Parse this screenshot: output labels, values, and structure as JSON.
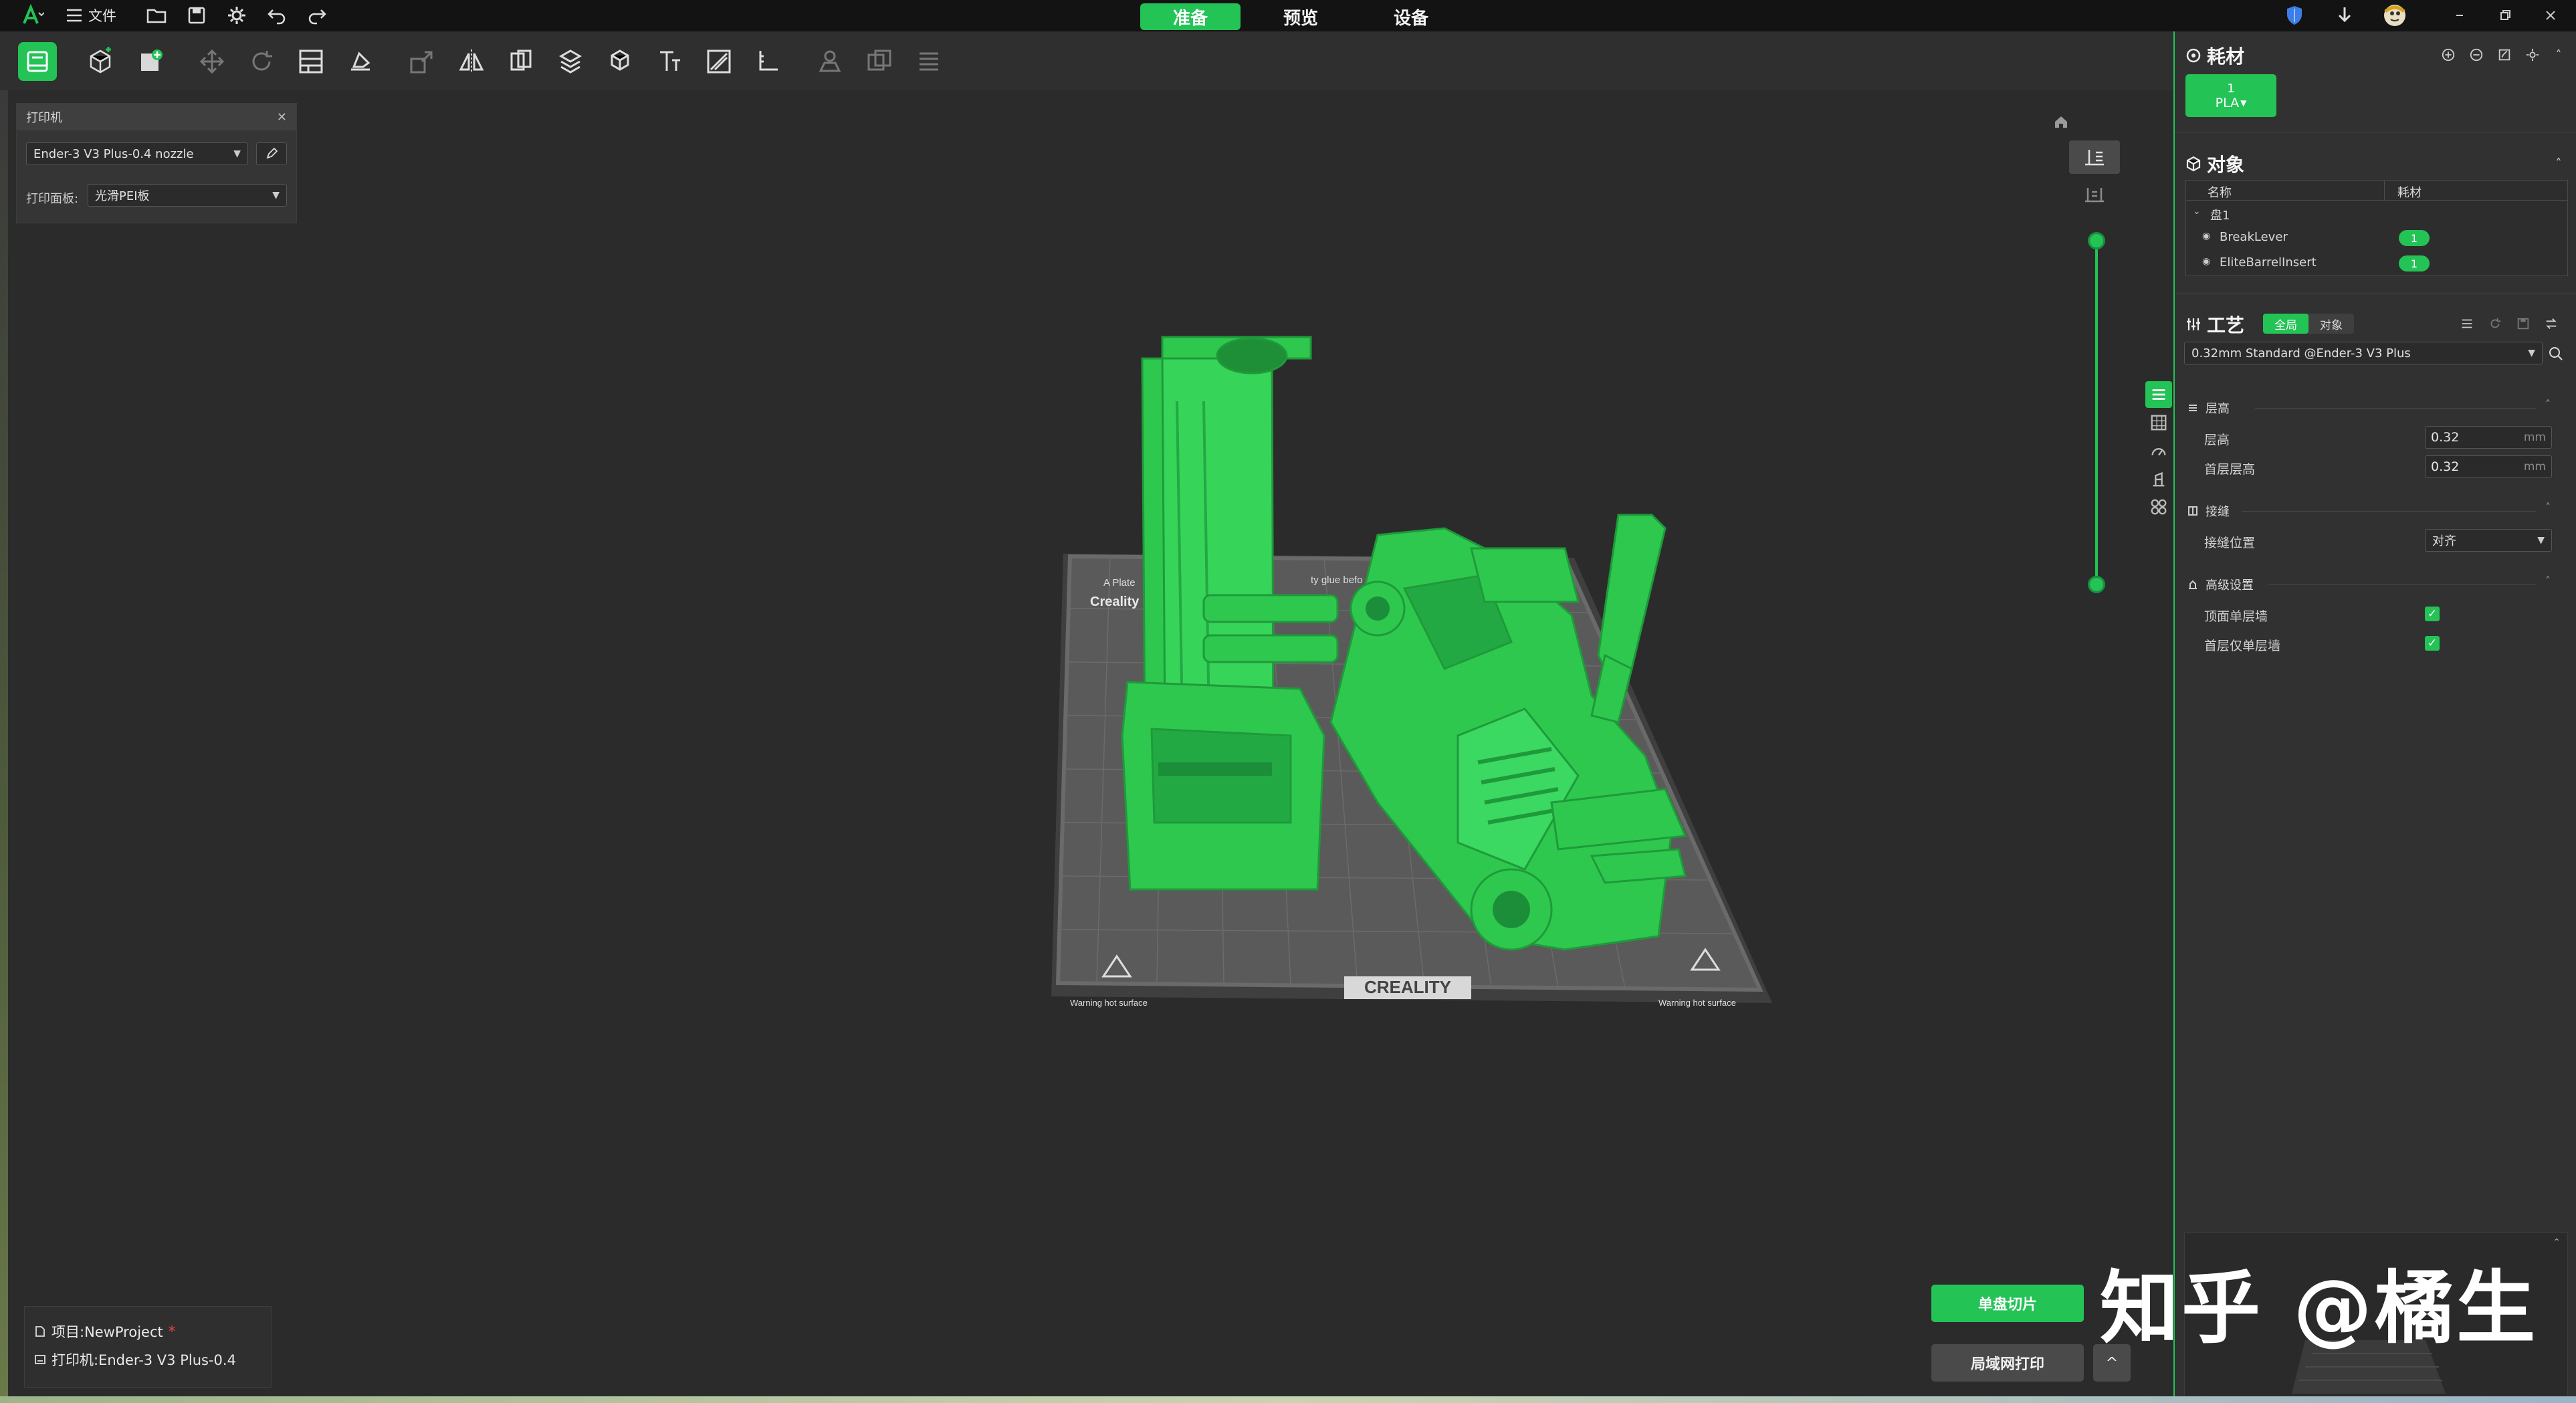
{
  "titlebar": {
    "file_menu": "文件",
    "tabs": {
      "prepare": "准备",
      "preview": "预览",
      "device": "设备"
    },
    "window_controls": [
      "minimize-icon",
      "restore-icon",
      "close-icon"
    ]
  },
  "toolbar": {
    "tools": [
      "add-plate-icon",
      "add-object-icon",
      "add-model-icon",
      "auto-orient-icon",
      "rotate-icon",
      "arrange-icon",
      "lay-on-face-icon",
      "scale-icon",
      "mirror-icon",
      "split-icon",
      "cut-icon",
      "support-paint-icon",
      "seam-paint-icon",
      "text-icon",
      "color-paint-icon",
      "measure-icon",
      "assembly-icon",
      "boolean-icon",
      "layers-icon"
    ]
  },
  "printer_panel": {
    "title": "打印机",
    "printer": "Ender-3 V3 Plus-0.4 nozzle",
    "plate_label": "打印面板:",
    "plate_value": "光滑PEI板"
  },
  "scene": {
    "bed_brand": "Creality",
    "bed_logo": "CREALITY",
    "bed_top_left_text": "A Plate",
    "bed_top_text": "ty glue befo",
    "warning_text": "Warning hot surface",
    "model_color": "#2ec84f"
  },
  "sidebar": {
    "filament": {
      "title": "耗材",
      "slot_number": "1",
      "slot_type": "PLA"
    },
    "objects": {
      "title": "对象",
      "col_name": "名称",
      "col_filament": "耗材",
      "plate": "盘1",
      "items": [
        {
          "name": "BreakLever",
          "filament": "1"
        },
        {
          "name": "EliteBarrelInsert",
          "filament": "1"
        }
      ]
    },
    "process": {
      "title": "工艺",
      "toggle_global": "全局",
      "toggle_object": "对象",
      "preset": "0.32mm Standard @Ender-3 V3 Plus",
      "group_layer": "层高",
      "layer_height_label": "层高",
      "layer_height_value": "0.32",
      "first_layer_label": "首层层高",
      "first_layer_value": "0.32",
      "unit": "mm",
      "group_seam": "接缝",
      "seam_label": "接缝位置",
      "seam_value": "对齐",
      "group_advanced": "高级设置",
      "top_single_wall_label": "顶面单层墙",
      "first_single_wall_label": "首层仅单层墙"
    }
  },
  "bottom": {
    "project_label": "项目:NewProject",
    "project_modified": "*",
    "printer_label": "打印机:Ender-3 V3 Plus-0.4",
    "slice_button": "单盘切片",
    "print_button": "局域网打印",
    "expand_button": "^"
  },
  "watermark": "知乎 @橘生",
  "colors": {
    "accent": "#23c356",
    "background": "#2b2b2b",
    "panel": "#313131"
  }
}
